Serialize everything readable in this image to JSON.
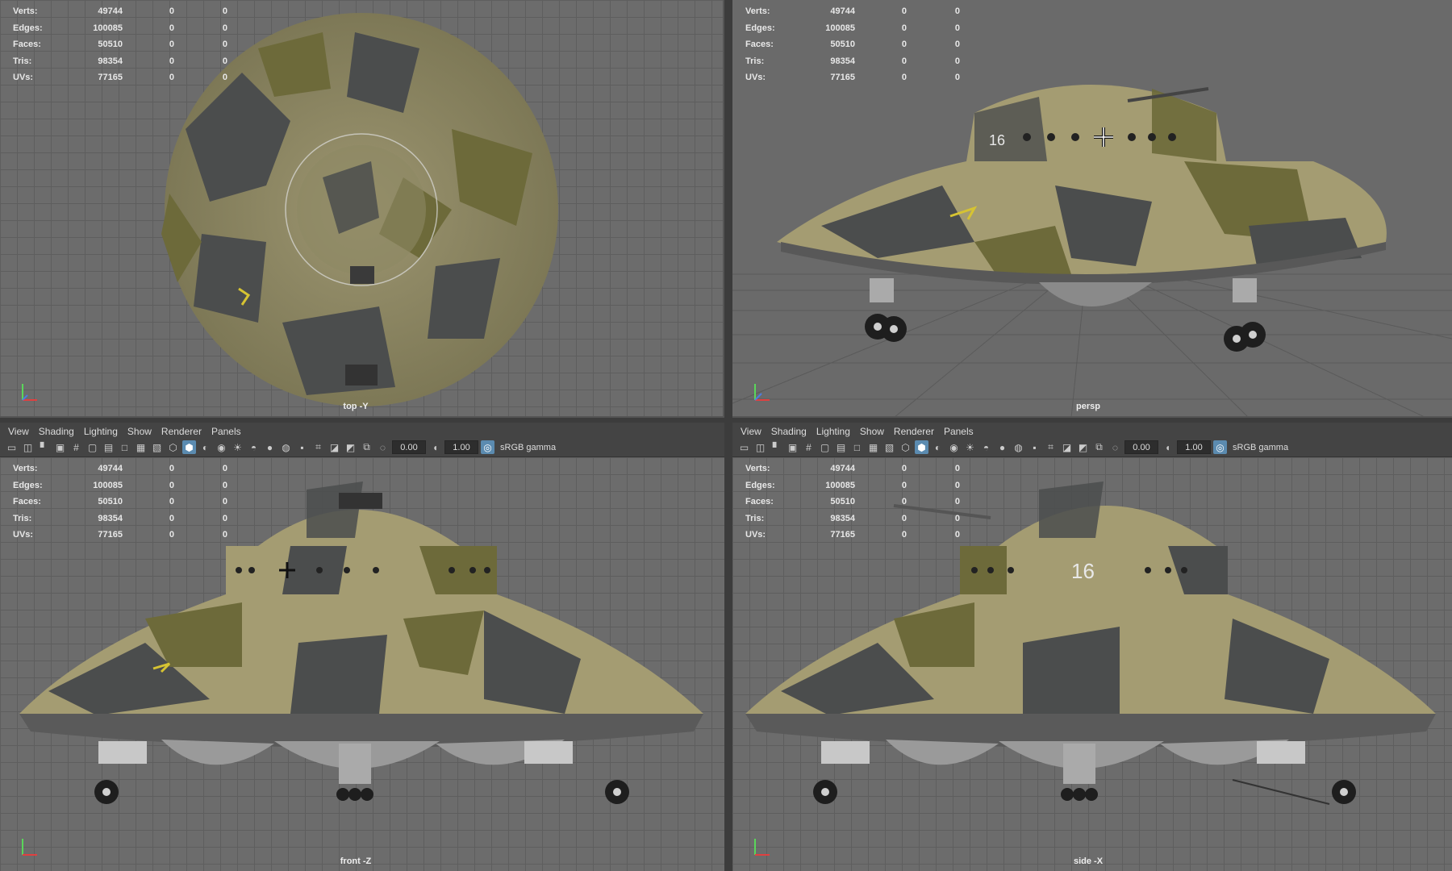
{
  "hud_stats": [
    {
      "label": "Verts:",
      "values": [
        "49744",
        "0",
        "0"
      ]
    },
    {
      "label": "Edges:",
      "values": [
        "100085",
        "0",
        "0"
      ]
    },
    {
      "label": "Faces:",
      "values": [
        "50510",
        "0",
        "0"
      ]
    },
    {
      "label": "Tris:",
      "values": [
        "98354",
        "0",
        "0"
      ]
    },
    {
      "label": "UVs:",
      "values": [
        "77165",
        "0",
        "0"
      ]
    }
  ],
  "viewports": {
    "top": {
      "camera": "top -Y"
    },
    "persp": {
      "camera": "persp"
    },
    "front": {
      "camera": "front -Z"
    },
    "side": {
      "camera": "side -X"
    }
  },
  "panel_menu": [
    "View",
    "Shading",
    "Lighting",
    "Show",
    "Renderer",
    "Panels"
  ],
  "toolbar": {
    "exposure": "0.00",
    "gamma": "1.00",
    "color_space": "sRGB gamma"
  },
  "decals": {
    "hull_number": "16"
  },
  "colors": {
    "viewport_bg": "#6c6c6c",
    "menu_bg": "#444444",
    "accent": "#5b8bb0",
    "camo_tan": "#a49c72",
    "camo_olive": "#6d6a3a",
    "camo_gray": "#4b4d4d"
  }
}
